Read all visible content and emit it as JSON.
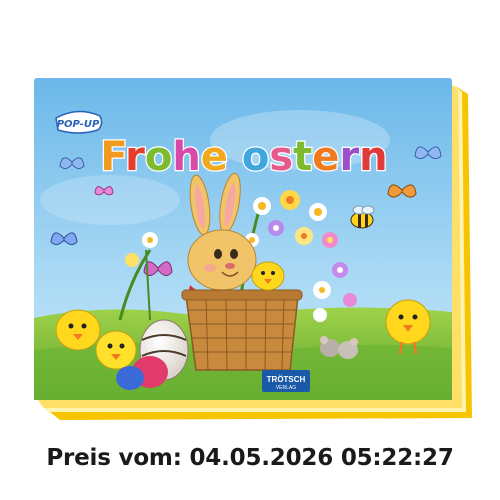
{
  "cover": {
    "badge_text": "POP-UP",
    "title_letters": [
      "F",
      "r",
      "o",
      "h",
      "e",
      " ",
      "o",
      "s",
      "t",
      "e",
      "r",
      "n"
    ],
    "title_colors": [
      "#f29a1e",
      "#e63c2a",
      "#7cbb2e",
      "#d94aa8",
      "#f2a91e",
      "#ffffff",
      "#3fa6e0",
      "#e85a8c",
      "#7cbb2e",
      "#f07a1e",
      "#9b4fc8",
      "#e23a3a"
    ],
    "publisher": "TRÖTSCH",
    "publisher_sub": "VERLAG"
  },
  "price_caption": {
    "text": "Preis vom: 04.05.2026 05:22:27"
  },
  "colors": {
    "sky_top": "#7fc3ec",
    "sky_bottom": "#b9e0f6",
    "grass": "#7fbf3a",
    "page_edge": "#f6c400",
    "basket": "#c98a3e",
    "chick": "#ffd81e",
    "bunny": "#f2c46a"
  }
}
